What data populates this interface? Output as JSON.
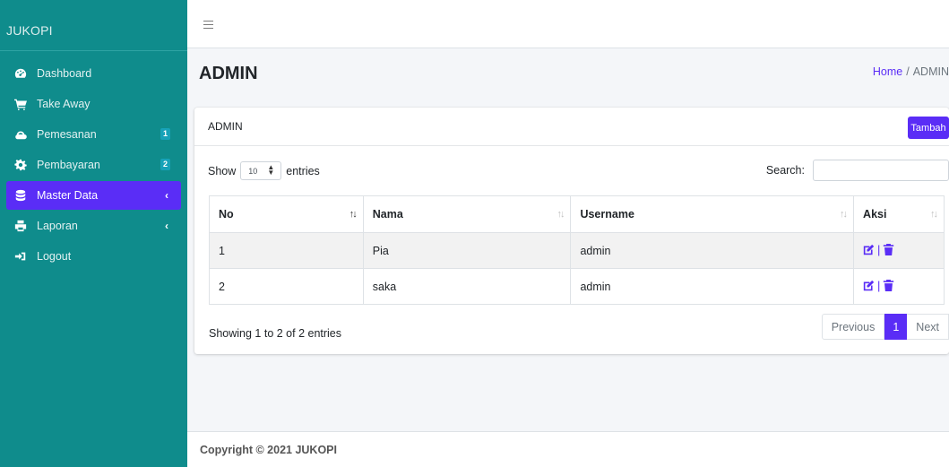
{
  "sidebar": {
    "brand": "JUKOPI",
    "items": [
      {
        "label": "Dashboard",
        "icon": "dashboard-icon"
      },
      {
        "label": "Take Away",
        "icon": "cart-icon"
      },
      {
        "label": "Pemesanan",
        "icon": "cloud-icon",
        "badge": "1"
      },
      {
        "label": "Pembayaran",
        "icon": "cog-icon",
        "badge": "2"
      },
      {
        "label": "Master Data",
        "icon": "database-icon",
        "active": true,
        "chevron": "‹"
      },
      {
        "label": "Laporan",
        "icon": "print-icon",
        "chevron": "‹"
      },
      {
        "label": "Logout",
        "icon": "logout-icon"
      }
    ]
  },
  "page": {
    "title": "ADMIN",
    "breadcrumb": {
      "home": "Home",
      "separator": "/",
      "current": "ADMIN"
    }
  },
  "card": {
    "title": "ADMIN",
    "add_button": "Tambah"
  },
  "datatable": {
    "show_label": "Show",
    "length_value": "10",
    "entries_label": "entries",
    "search_label": "Search:",
    "search_value": "",
    "columns": [
      "No",
      "Nama",
      "Username",
      "Aksi"
    ],
    "rows": [
      {
        "no": "1",
        "nama": "Pia",
        "username": "admin"
      },
      {
        "no": "2",
        "nama": "saka",
        "username": "admin"
      }
    ],
    "info": "Showing 1 to 2 of 2 entries",
    "pagination": {
      "previous": "Previous",
      "current": "1",
      "next": "Next"
    }
  },
  "footer": {
    "text": "Copyright © 2021 JUKOPI"
  },
  "colors": {
    "sidebar": "#0f8c8c",
    "accent": "#5a2df6",
    "badge": "#17a2b8"
  }
}
